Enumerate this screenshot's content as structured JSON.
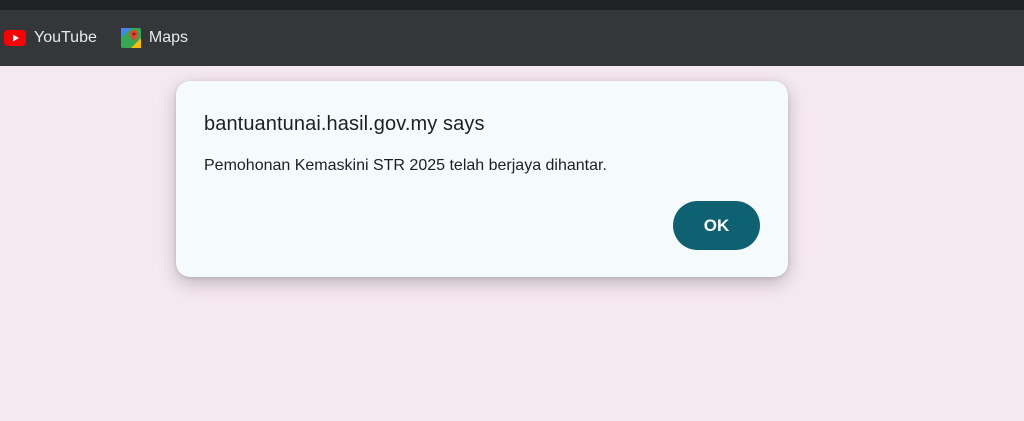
{
  "bookmarks_bar": {
    "items": [
      {
        "label": "YouTube",
        "icon": "youtube-icon"
      },
      {
        "label": "Maps",
        "icon": "google-maps-icon"
      }
    ]
  },
  "dialog": {
    "title": "bantuantunai.hasil.gov.my says",
    "message": "Pemohonan Kemaskini STR 2025 telah berjaya dihantar.",
    "ok_label": "OK"
  },
  "colors": {
    "page_background": "#f4e9ef",
    "dialog_background": "#f5fbfd",
    "ok_button": "#0d6170",
    "bookmarks_bar": "#35363a"
  }
}
